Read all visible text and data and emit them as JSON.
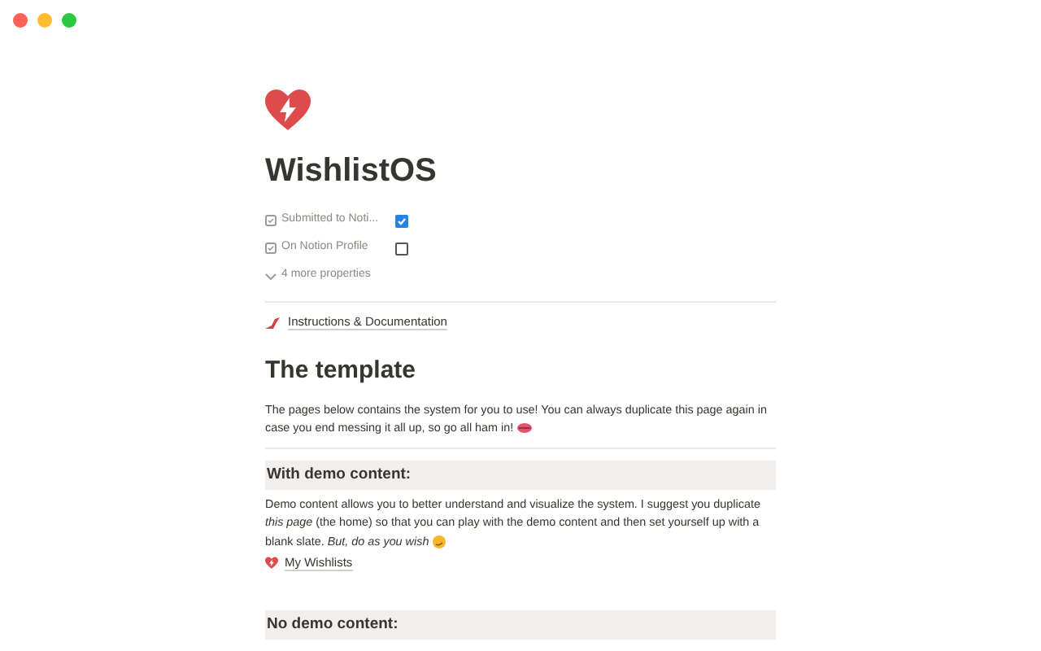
{
  "page": {
    "title": "WishlistOS",
    "properties": [
      {
        "label": "Submitted to Noti...",
        "checked": true
      },
      {
        "label": "On Notion Profile",
        "checked": false
      }
    ],
    "more_properties": "4 more properties",
    "blocks": [
      {
        "kind": "divider"
      },
      {
        "kind": "link",
        "text": "Instructions & Documentation"
      },
      {
        "kind": "h1",
        "text": "The template"
      },
      {
        "kind": "text",
        "text": "The pages below contains the system for you to use! You can always duplicate this page again in case you end messing it all up, so go all ham in!",
        "emoji": true
      },
      {
        "kind": "divider"
      },
      {
        "kind": "callout",
        "text": "With demo content:"
      },
      {
        "kind": "text",
        "text": "Demo content allows you to better understand and visualize the system. I suggest you duplicate *this page* (the home) so that you can play with the demo content and then set yourself up with a blank slate. *But, do as you wish*",
        "emoji": true
      },
      {
        "kind": "page",
        "text": "My Wishlists"
      },
      {
        "kind": "callout",
        "text": "No demo content:"
      }
    ]
  }
}
